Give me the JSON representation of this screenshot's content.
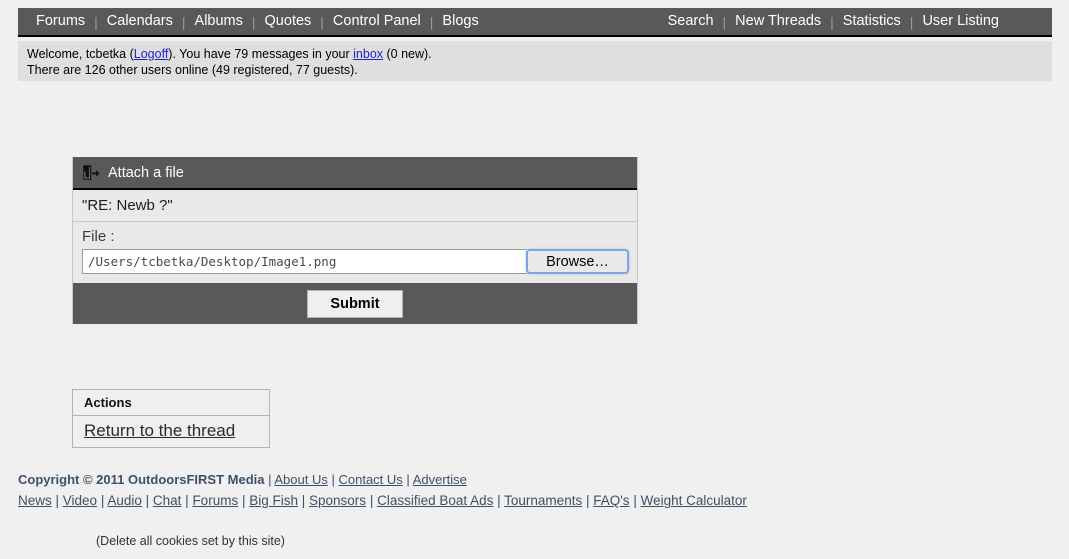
{
  "nav": {
    "left_items": [
      {
        "label": "Forums"
      },
      {
        "label": "Calendars"
      },
      {
        "label": "Albums"
      },
      {
        "label": "Quotes"
      },
      {
        "label": "Control Panel"
      },
      {
        "label": "Blogs"
      }
    ],
    "right_items": [
      {
        "label": "Search"
      },
      {
        "label": "New Threads"
      },
      {
        "label": "Statistics"
      },
      {
        "label": "User Listing"
      }
    ],
    "separator": "|",
    "background_color": "#595959",
    "text_color": "#ffffff"
  },
  "welcome": {
    "line1_prefix": "Welcome, tcbetka (",
    "logoff_label": "Logoff",
    "line1_middle": "). You have 79 messages in your ",
    "inbox_label": "inbox",
    "line1_suffix": " (0 new).",
    "line2": "There are 126 other users online (49 registered, 77 guests).",
    "link_color": "#2222cc",
    "background_color": "#dfdfdf"
  },
  "attach_panel": {
    "header_title": "Attach a file",
    "header_icon": "attach-file-icon",
    "subject": "\"RE: Newb ?\"",
    "file_label": "File :",
    "file_value": "/Users/tcbetka/Desktop/Image1.png",
    "browse_label": "Browse…",
    "submit_label": "Submit",
    "header_background": "#595959",
    "body_background": "#e9e9e7",
    "focus_ring_color": "#7da7d9"
  },
  "actions": {
    "title": "Actions",
    "return_link": "Return to the thread"
  },
  "footer": {
    "copyright": "Copyright © 2011 OutdoorsFIRST Media",
    "top_links": [
      {
        "label": "About Us"
      },
      {
        "label": "Contact Us"
      },
      {
        "label": "Advertise"
      }
    ],
    "bottom_links": [
      {
        "label": "News"
      },
      {
        "label": "Video"
      },
      {
        "label": "Audio"
      },
      {
        "label": "Chat"
      },
      {
        "label": "Forums"
      },
      {
        "label": "Big Fish"
      },
      {
        "label": "Sponsors"
      },
      {
        "label": "Classified Boat Ads"
      },
      {
        "label": "Tournaments"
      },
      {
        "label": "FAQ's"
      },
      {
        "label": "Weight Calculator"
      }
    ],
    "separator": "|",
    "cookies_note": "(Delete all cookies set by this site)",
    "link_color": "#3d5166"
  }
}
